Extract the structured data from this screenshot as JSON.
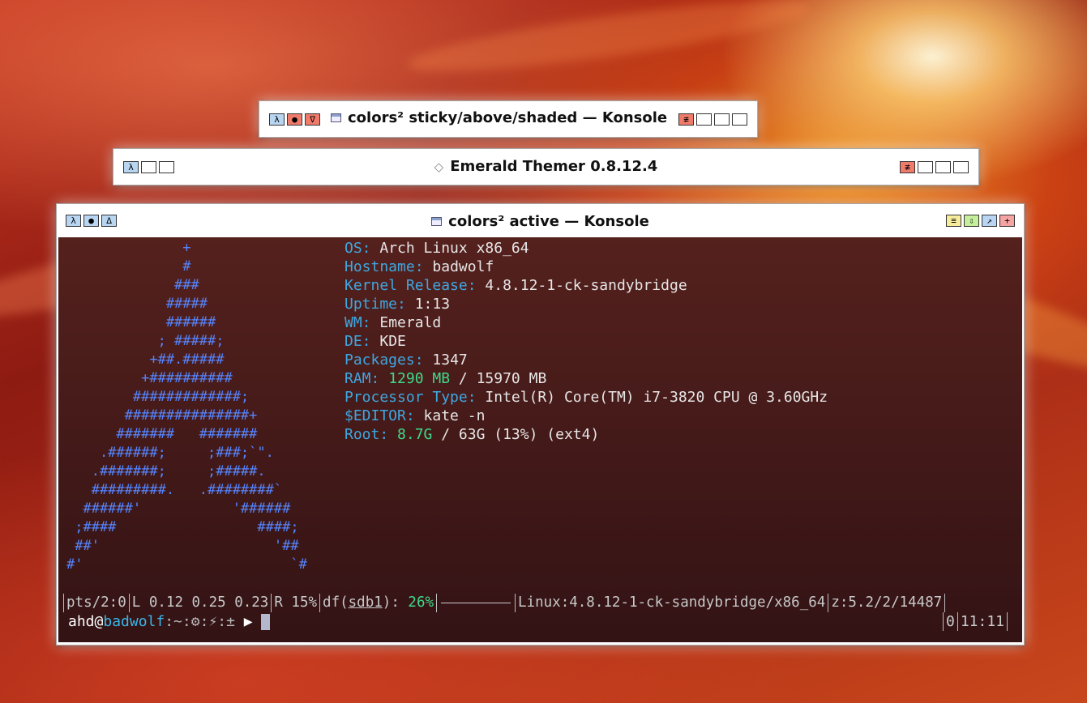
{
  "window1": {
    "left_buttons": [
      "λ",
      "●",
      "∇"
    ],
    "title": "colors² sticky/above/shaded — Konsole",
    "right_buttons": [
      "≢",
      "",
      "",
      ""
    ]
  },
  "window2": {
    "left_buttons": [
      "λ",
      "",
      ""
    ],
    "title": "Emerald Themer 0.8.12.4",
    "right_buttons": [
      "≢",
      "",
      "",
      ""
    ]
  },
  "window3": {
    "left_buttons": [
      "λ",
      "●",
      "∆"
    ],
    "title": "colors² active — Konsole",
    "right_buttons": [
      "≡",
      "⇩",
      "↗",
      "+"
    ]
  },
  "terminal": {
    "ascii_art": "              +\n              #\n             ###\n            #####\n            ######\n           ; #####;\n          +##.#####\n         +##########\n        #############;\n       ###############+\n      #######   #######\n    .######;     ;###;`\".\n   .#######;     ;#####.\n   #########.   .########`\n  ######'           '######\n ;####                 ####;\n ##'                     '##\n#'                         `#",
    "info": [
      {
        "key": "OS:",
        "value": "Arch Linux x86_64"
      },
      {
        "key": "Hostname:",
        "value": "badwolf"
      },
      {
        "key": "Kernel Release:",
        "value": "4.8.12-1-ck-sandybridge"
      },
      {
        "key": "Uptime:",
        "value": "1:13"
      },
      {
        "key": "WM:",
        "value": "Emerald"
      },
      {
        "key": "DE:",
        "value": "KDE"
      },
      {
        "key": "Packages:",
        "value": "1347"
      }
    ],
    "ram": {
      "key": "RAM:",
      "used": "1290 MB",
      "rest": "/ 15970 MB"
    },
    "processor": {
      "key": "Processor Type:",
      "value": "Intel(R) Core(TM) i7-3820 CPU @ 3.60GHz"
    },
    "editor": {
      "key": "$EDITOR:",
      "value": "kate -n"
    },
    "root": {
      "key": "Root:",
      "used": "8.7G",
      "rest": "/ 63G (13%) (ext4)"
    },
    "status": {
      "pts": "pts/2:0",
      "load": "L 0.12 0.25 0.23",
      "r": "R 15%",
      "df_prefix": "df(",
      "df_dev": "sdb1",
      "df_mid": "): ",
      "df_pct": "26%",
      "kernel": "Linux:4.8.12-1-ck-sandybridge/x86_64",
      "zsh": "z:5.2/2/14487"
    },
    "prompt": {
      "user": "ahd",
      "at": "@",
      "host": "badwolf",
      "path": ":~:⚙:⚡:±",
      "arrow": " ▶ "
    },
    "right_status": {
      "jobs": "0",
      "time": "11:11"
    }
  }
}
